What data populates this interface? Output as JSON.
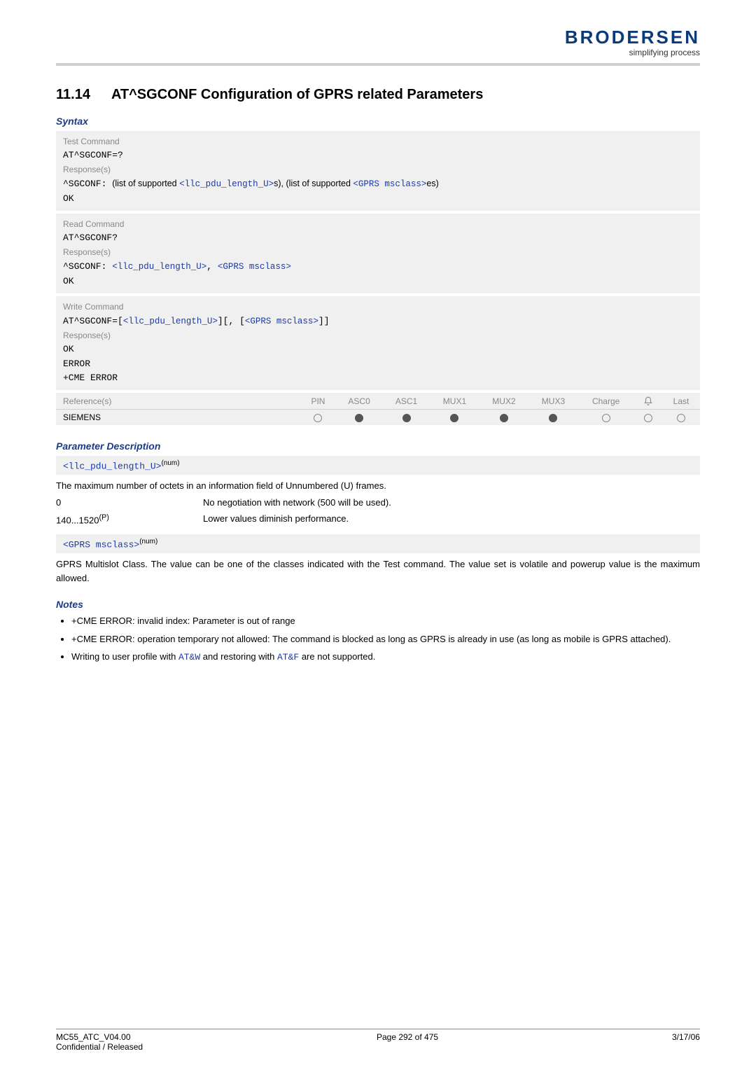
{
  "header": {
    "brand": "BRODERSEN",
    "tagline": "simplifying process"
  },
  "section": {
    "number": "11.14",
    "title": "AT^SGCONF   Configuration of GPRS related Parameters"
  },
  "syntax": {
    "heading": "Syntax",
    "test": {
      "label": "Test Command",
      "cmd": "AT^SGCONF=?",
      "resp_label": "Response(s)",
      "resp_prefix": "^SGCONF: ",
      "resp_text1": "(list of supported ",
      "resp_param1": "<llc_pdu_length_U>",
      "resp_text2": "s), (list of supported ",
      "resp_param2": "<GPRS msclass>",
      "resp_text3": "es)",
      "ok": "OK"
    },
    "read": {
      "label": "Read Command",
      "cmd": "AT^SGCONF?",
      "resp_label": "Response(s)",
      "resp_prefix": "^SGCONF: ",
      "resp_param1": "<llc_pdu_length_U>",
      "resp_sep": ", ",
      "resp_param2": "<GPRS msclass>",
      "ok": "OK"
    },
    "write": {
      "label": "Write Command",
      "cmd_prefix": "AT^SGCONF=[",
      "cmd_param1": "<llc_pdu_length_U>",
      "cmd_mid": "][, [",
      "cmd_param2": "<GPRS msclass>",
      "cmd_suffix": "]]",
      "resp_label": "Response(s)",
      "ok": "OK",
      "error": "ERROR",
      "cme": "+CME ERROR"
    },
    "refs": {
      "label": "Reference(s)",
      "value": "SIEMENS",
      "cols": [
        "PIN",
        "ASC0",
        "ASC1",
        "MUX1",
        "MUX2",
        "MUX3",
        "Charge",
        "",
        "Last"
      ],
      "dots": [
        "empty",
        "filled",
        "filled",
        "filled",
        "filled",
        "filled",
        "empty",
        "empty",
        "empty"
      ]
    }
  },
  "params": {
    "heading": "Parameter Description",
    "p1": {
      "name": "<llc_pdu_length_U>",
      "sup": "(num)",
      "desc": "The maximum number of octets in an information field of Unnumbered (U) frames.",
      "row1_key": "0",
      "row1_val": "No negotiation with network (500 will be used).",
      "row2_key_a": "140...1520",
      "row2_key_sup": "(P)",
      "row2_val": "Lower values diminish performance."
    },
    "p2": {
      "name": "<GPRS msclass>",
      "sup": "(num)",
      "desc": "GPRS Multislot Class. The value can be one of the classes indicated with the Test command. The value set is volatile and powerup value is the maximum allowed."
    }
  },
  "notes": {
    "heading": "Notes",
    "n1": "+CME ERROR: invalid index: Parameter is out of range",
    "n2": "+CME ERROR: operation temporary not allowed: The command is blocked as long as GPRS is already in use (as long as mobile is GPRS attached).",
    "n3_a": "Writing to user profile with ",
    "n3_cmd1": "AT&W",
    "n3_b": " and restoring with ",
    "n3_cmd2": "AT&F",
    "n3_c": " are not supported."
  },
  "footer": {
    "doc": "MC55_ATC_V04.00",
    "conf": "Confidential / Released",
    "page": "Page 292 of 475",
    "date": "3/17/06"
  }
}
